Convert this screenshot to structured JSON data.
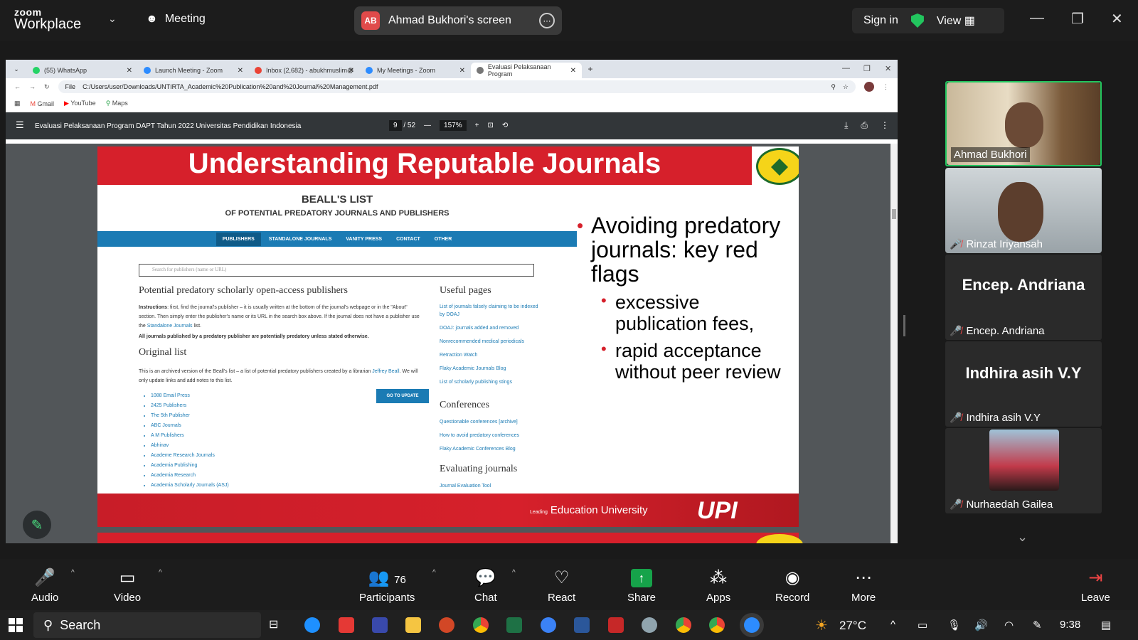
{
  "zoom_header": {
    "logo_top": "zoom",
    "logo_bottom": "Workplace",
    "meeting_label": "Meeting",
    "screen_initials": "AB",
    "screen_share_label": "Ahmad Bukhori's screen",
    "sign_in": "Sign in",
    "view": "View"
  },
  "browser": {
    "tabs": [
      {
        "label": "(55) WhatsApp",
        "color": "#25d366"
      },
      {
        "label": "Launch Meeting - Zoom",
        "color": "#2d8cff"
      },
      {
        "label": "Inbox (2,682) - abukhmuslim@",
        "color": "#ea4335"
      },
      {
        "label": "My Meetings - Zoom",
        "color": "#2d8cff"
      },
      {
        "label": "Evaluasi Pelaksanaan Program",
        "color": "#555555"
      }
    ],
    "url_scheme": "File",
    "url": "C:/Users/user/Downloads/UNTIRTA_Academic%20Publication%20and%20Journal%20Management.pdf",
    "bookmarks": [
      "Gmail",
      "YouTube",
      "Maps"
    ]
  },
  "pdf": {
    "title": "Evaluasi Pelaksanaan Program DAPT Tahun 2022 Universitas Pendidikan Indonesia",
    "page_current": "9",
    "page_total": "/ 52",
    "zoom": "157%"
  },
  "slide": {
    "heading": "Understanding Reputable Journals",
    "beall": {
      "title": "BEALL'S LIST",
      "subtitle": "OF POTENTIAL PREDATORY JOURNALS AND PUBLISHERS",
      "nav": [
        "PUBLISHERS",
        "STANDALONE JOURNALS",
        "VANITY PRESS",
        "CONTACT",
        "OTHER"
      ],
      "search_placeholder": "Search for publishers (name or URL)",
      "section1_title": "Potential predatory scholarly open-access publishers",
      "instructions_label": "Instructions",
      "instructions": ": first, find the journal's publisher – it is usually written at the bottom of the journal's webpage or in the \"About\" section. Then simply enter the publisher's name or its URL in the search box above. If the journal does not have a publisher use the",
      "instructions_link": "Standalone Journals",
      "instructions_end": "list.",
      "bold_note": "All journals published by a predatory publisher are potentially predatory unless stated otherwise.",
      "section2_title": "Original list",
      "go_update": "GO TO UPDATE",
      "archive_text": "This is an archived version of the Beall's list – a list of potential predatory publishers created by a librarian",
      "archive_link": "Jeffrey Beall",
      "archive_end": ". We will only update links and add notes to this list.",
      "publishers": [
        "1088 Email Press",
        "2425 Publishers",
        "The 5th Publisher",
        "ABC Journals",
        "A M Publishers",
        "Abhinav",
        "Academe Research Journals",
        "Academia Publishing",
        "Academia Research",
        "Academia Scholarly Journals (ASJ)"
      ],
      "useful_title": "Useful pages",
      "useful_links": [
        "List of journals falsely claiming to be indexed by DOAJ",
        "DOAJ: journals added and removed",
        "Nonrecommended medical periodicals",
        "Retraction Watch",
        "Flaky Academic Journals Blog",
        "List of scholarly publishing stings"
      ],
      "conferences_title": "Conferences",
      "conference_links": [
        "Questionable conferences [archive]",
        "How to avoid predatory conferences",
        "Flaky Academic Conferences Blog"
      ],
      "evaluating_title": "Evaluating journals",
      "evaluating_links": [
        "Journal Evaluation Tool"
      ]
    },
    "bullet_main": "Avoiding predatory journals: key red flags",
    "bullet_subs": [
      "excessive publication fees,",
      "rapid acceptance without peer review"
    ],
    "footer_small": "Leading",
    "footer_text": "Education University",
    "footer_logo": "UPI"
  },
  "participants_panel": [
    {
      "name": "Ahmad Bukhori",
      "speaking": true,
      "video": true
    },
    {
      "name": "Rinzat Iriyansah",
      "muted": true,
      "video": true
    },
    {
      "name": "Encep. Andriana",
      "muted": true,
      "video": false
    },
    {
      "name": "Indhira asih V.Y",
      "muted": true,
      "video": false
    },
    {
      "name": "Nurhaedah Gailea",
      "muted": true,
      "video": true
    }
  ],
  "controls": {
    "audio": "Audio",
    "video": "Video",
    "participants": "Participants",
    "participants_count": "76",
    "chat": "Chat",
    "react": "React",
    "share": "Share",
    "apps": "Apps",
    "record": "Record",
    "more": "More",
    "leave": "Leave"
  },
  "taskbar": {
    "search": "Search",
    "temperature": "27°C",
    "time": "9:38"
  }
}
